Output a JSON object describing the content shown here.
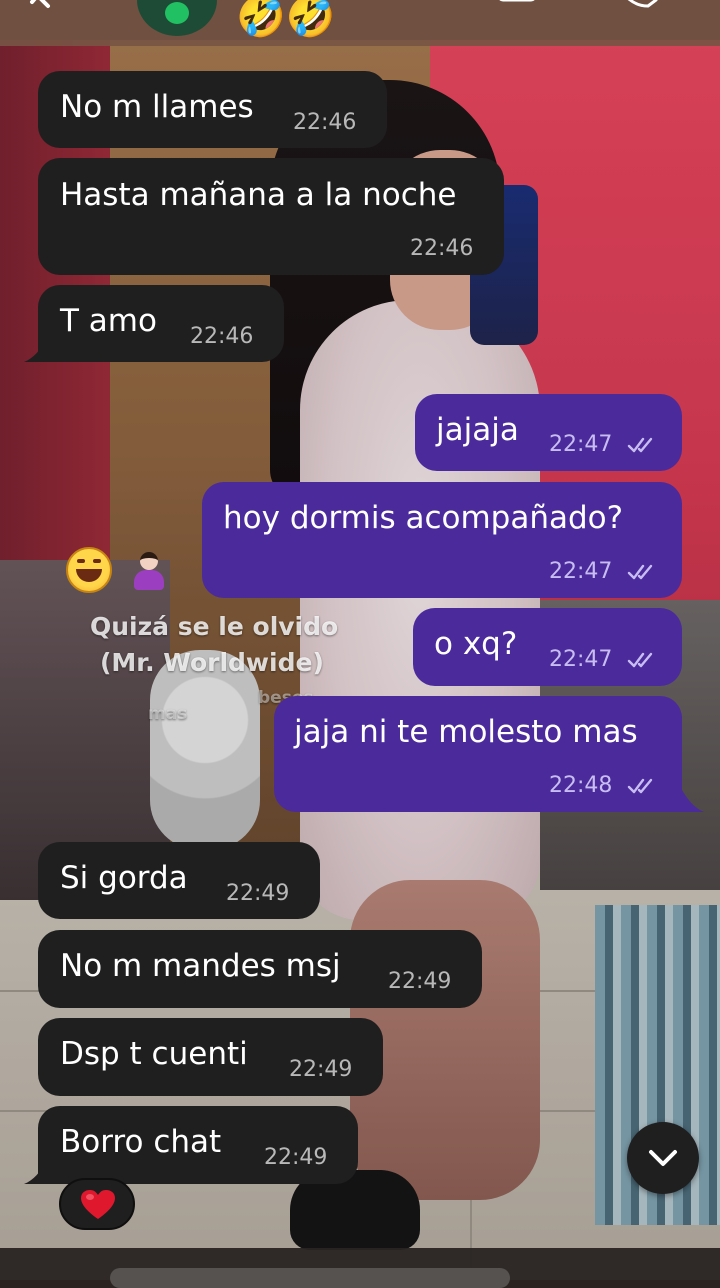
{
  "header": {
    "contact_name": "🤣🤣",
    "icons": [
      "back-arrow",
      "avatar",
      "video-call",
      "voice-call"
    ]
  },
  "messages": [
    {
      "dir": "in",
      "text": "No m llames",
      "time": "22:46"
    },
    {
      "dir": "in",
      "text": "Hasta mañana a la noche",
      "time": "22:46"
    },
    {
      "dir": "in",
      "text": "T amo",
      "time": "22:46"
    },
    {
      "dir": "out",
      "text": "jajaja",
      "time": "22:47",
      "status": "read"
    },
    {
      "dir": "out",
      "text": "hoy dormis acompañado?",
      "time": "22:47",
      "status": "read"
    },
    {
      "dir": "out",
      "text": "o xq?",
      "time": "22:47",
      "status": "read"
    },
    {
      "dir": "out",
      "text": "jaja ni te molesto mas",
      "time": "22:48",
      "status": "read"
    },
    {
      "dir": "in",
      "text": "Si gorda",
      "time": "22:49"
    },
    {
      "dir": "in",
      "text": "No m mandes msj",
      "time": "22:49"
    },
    {
      "dir": "in",
      "text": "Dsp t cuenti",
      "time": "22:49"
    },
    {
      "dir": "in",
      "text": "Borro chat",
      "time": "22:49"
    }
  ],
  "background_overlay": {
    "line1": "Quizá se le olvido",
    "line2": "(Mr. Worldwide)",
    "line3": "besos",
    "line4": "mas",
    "line5": "ldes"
  },
  "reaction": {
    "emoji": "heart"
  },
  "colors": {
    "incoming_bubble": "#1f1f1f",
    "outgoing_bubble": "#4b2a9c",
    "topbar": "#765544",
    "read_ticks": "#c8bdf0"
  }
}
